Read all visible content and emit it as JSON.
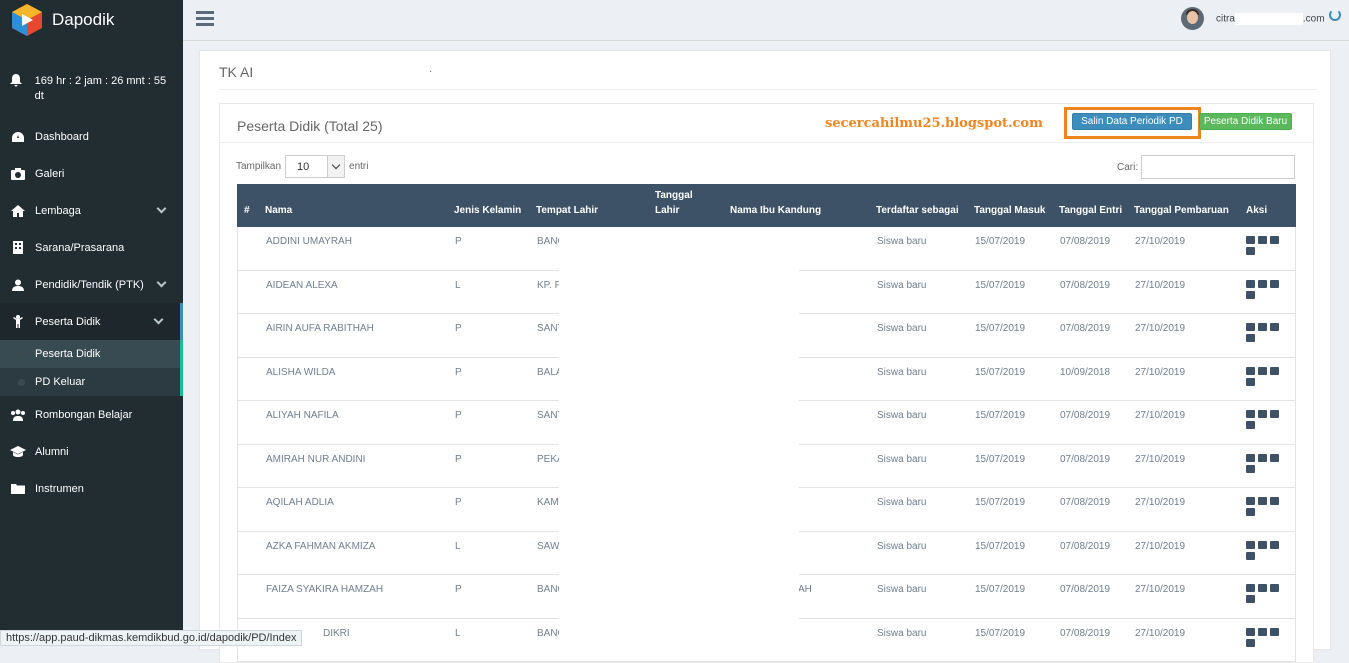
{
  "app": {
    "name": "Dapodik",
    "timer": "169 hr : 2 jam : 26 mnt : 55 dt"
  },
  "sidebar": {
    "items": [
      {
        "label": "Dashboard",
        "icon": "dashboard-icon"
      },
      {
        "label": "Galeri",
        "icon": "camera-icon"
      },
      {
        "label": "Lembaga",
        "icon": "home-icon",
        "chevron": true
      },
      {
        "label": "Sarana/Prasarana",
        "icon": "building-icon"
      },
      {
        "label": "Pendidik/Tendik (PTK)",
        "icon": "user-icon",
        "chevron": true
      },
      {
        "label": "Peserta Didik",
        "icon": "child-icon",
        "chevron": true
      }
    ],
    "sub_items": [
      {
        "label": "Peserta Didik"
      },
      {
        "label": "PD Keluar"
      }
    ],
    "items_after": [
      {
        "label": "Rombongan Belajar",
        "icon": "users-icon"
      },
      {
        "label": "Alumni",
        "icon": "graduation-cap-icon"
      },
      {
        "label": "Instrumen",
        "icon": "folder-icon"
      }
    ]
  },
  "topbar": {
    "user_prefix": "citra",
    "user_suffix": ".com"
  },
  "page": {
    "school": "TK AI",
    "school_dot": "."
  },
  "box": {
    "title": "Peserta Didik (Total 25)",
    "watermark": "secercahilmu25.blogspot.com",
    "btn_copy": "Salin Data Periodik PD",
    "btn_new": "Peserta Didik Baru",
    "len_label_before": "Tampilkan",
    "len_value": "10",
    "len_label_after": "entri",
    "search_label": "Cari:"
  },
  "table": {
    "headers": [
      "#",
      "Nama",
      "Jenis Kelamin",
      "Tempat Lahir",
      "Tanggal Lahir",
      "Nama Ibu Kandung",
      "Terdaftar sebagai",
      "Tanggal Masuk",
      "Tanggal Entri",
      "Tanggal Pembaruan",
      "Aksi"
    ],
    "rows": [
      {
        "nama": "ADDINI UMAYRAH",
        "jk": "P",
        "tempat": "BANG",
        "ibu": "",
        "terdaftar": "Siswa baru",
        "masuk": "15/07/2019",
        "entri": "07/08/2019",
        "pembaruan": "27/10/2019"
      },
      {
        "nama": "AIDEAN ALEXA",
        "jk": "L",
        "tempat": "KP. P",
        "ibu": "",
        "terdaftar": "Siswa baru",
        "masuk": "15/07/2019",
        "entri": "07/08/2019",
        "pembaruan": "27/10/2019"
      },
      {
        "nama": "AIRIN AUFA RABITHAH",
        "jk": "P",
        "tempat": "SANT",
        "ibu": "",
        "terdaftar": "Siswa baru",
        "masuk": "15/07/2019",
        "entri": "07/08/2019",
        "pembaruan": "27/10/2019"
      },
      {
        "nama": "ALISHA WILDA",
        "jk": "P",
        "tempat": "BALA",
        "ibu": "",
        "terdaftar": "Siswa baru",
        "masuk": "15/07/2019",
        "entri": "10/09/2018",
        "pembaruan": "27/10/2019"
      },
      {
        "nama": "ALIYAH NAFILA",
        "jk": "P",
        "tempat": "SANT",
        "ibu": "",
        "terdaftar": "Siswa baru",
        "masuk": "15/07/2019",
        "entri": "07/08/2019",
        "pembaruan": "27/10/2019"
      },
      {
        "nama": "AMIRAH NUR ANDINI",
        "jk": "P",
        "tempat": "PEKA",
        "ibu": "",
        "terdaftar": "Siswa baru",
        "masuk": "15/07/2019",
        "entri": "07/08/2019",
        "pembaruan": "27/10/2019"
      },
      {
        "nama": "AQILAH ADLIA",
        "jk": "P",
        "tempat": "KAM",
        "ibu": "",
        "terdaftar": "Siswa baru",
        "masuk": "15/07/2019",
        "entri": "07/08/2019",
        "pembaruan": "27/10/2019"
      },
      {
        "nama": "AZKA FAHMAN AKMIZA",
        "jk": "L",
        "tempat": "SAW",
        "ibu": "",
        "terdaftar": "Siswa baru",
        "masuk": "15/07/2019",
        "entri": "07/08/2019",
        "pembaruan": "27/10/2019"
      },
      {
        "nama": "FAIZA SYAKIRA HAMZAH",
        "jk": "P",
        "tempat": "BANG",
        "ibu": "AH",
        "terdaftar": "Siswa baru",
        "masuk": "15/07/2019",
        "entri": "07/08/2019",
        "pembaruan": "27/10/2019"
      },
      {
        "nama": "DIKRI",
        "jk": "L",
        "tempat": "BANG",
        "ibu": "",
        "terdaftar": "Siswa baru",
        "masuk": "15/07/2019",
        "entri": "07/08/2019",
        "pembaruan": "27/10/2019"
      }
    ]
  },
  "statusbar": {
    "url": "https://app.paud-dikmas.kemdikbud.go.id/dapodik/PD/Index"
  },
  "colors": {
    "sidebar": "#222d32",
    "header": "#3d5266",
    "accent": "#3c8dbc",
    "green": "#5cb85c",
    "highlight": "#f0841f"
  }
}
